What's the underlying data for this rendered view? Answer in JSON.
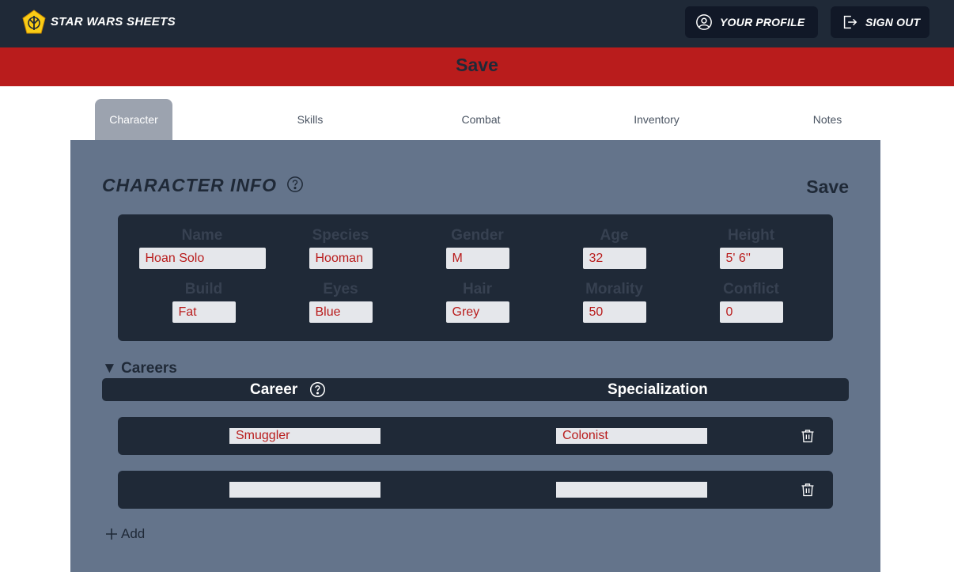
{
  "header": {
    "brand": "STAR WARS SHEETS",
    "logo_icon": "rebel-insignia-icon",
    "profile_label": "YOUR PROFILE",
    "signout_label": "SIGN OUT"
  },
  "save_bar": {
    "label": "Save"
  },
  "tabs": [
    {
      "label": "Character",
      "active": true
    },
    {
      "label": "Skills",
      "active": false
    },
    {
      "label": "Combat",
      "active": false
    },
    {
      "label": "Inventory",
      "active": false
    },
    {
      "label": "Notes",
      "active": false
    }
  ],
  "character_info": {
    "title": "CHARACTER INFO",
    "save_label": "Save",
    "fields": [
      {
        "label": "Name",
        "value": "Hoan Solo"
      },
      {
        "label": "Species",
        "value": "Hooman"
      },
      {
        "label": "Gender",
        "value": "M"
      },
      {
        "label": "Age",
        "value": "32"
      },
      {
        "label": "Height",
        "value": "5' 6''"
      },
      {
        "label": "Build",
        "value": "Fat"
      },
      {
        "label": "Eyes",
        "value": "Blue"
      },
      {
        "label": "Hair",
        "value": "Grey"
      },
      {
        "label": "Morality",
        "value": "50"
      },
      {
        "label": "Conflict",
        "value": "0"
      }
    ]
  },
  "careers": {
    "toggle_label": "▼ Careers",
    "career_header": "Career",
    "specialization_header": "Specialization",
    "rows": [
      {
        "career": "Smuggler",
        "specialization": "Colonist"
      },
      {
        "career": "",
        "specialization": ""
      }
    ],
    "add_label": "Add"
  },
  "colors": {
    "header_bg": "#1f2937",
    "save_bar_bg": "#b91c1c",
    "panel_bg": "#64748b",
    "input_text": "#b91c1c",
    "logo_fill": "#facc15"
  }
}
